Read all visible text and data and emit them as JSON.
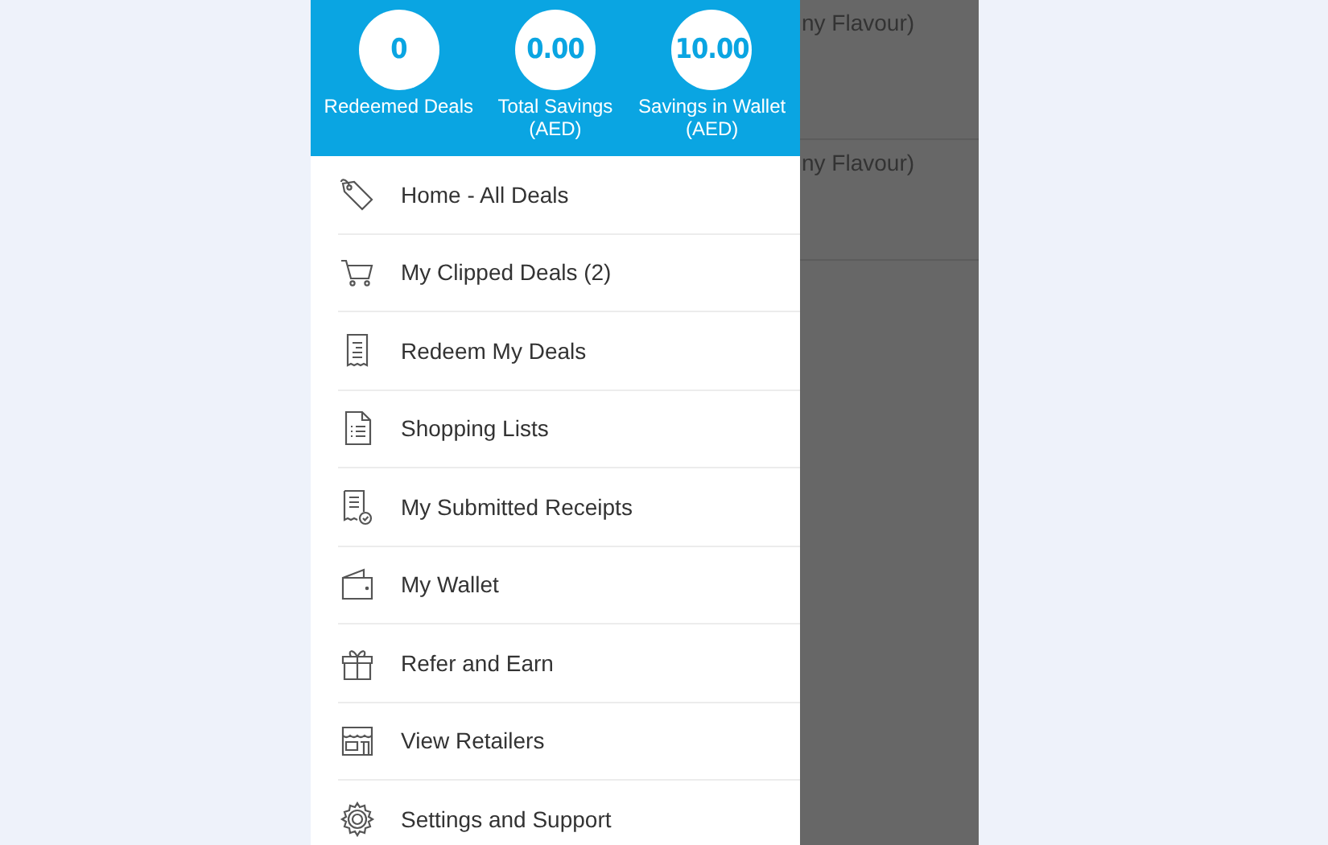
{
  "stats": [
    {
      "value": "0",
      "label": "Redeemed Deals"
    },
    {
      "value": "0.00",
      "label": "Total Savings (AED)"
    },
    {
      "value": "10.00",
      "label": "Savings in Wallet (AED)"
    }
  ],
  "menu": [
    {
      "label": "Home - All Deals",
      "kind": "tag"
    },
    {
      "label": "My Clipped Deals (2)",
      "kind": "cart"
    },
    {
      "label": "Redeem My Deals",
      "kind": "receipt"
    },
    {
      "label": "Shopping Lists",
      "kind": "list"
    },
    {
      "label": "My Submitted Receipts",
      "kind": "submitted"
    },
    {
      "label": "My Wallet",
      "kind": "wallet"
    },
    {
      "label": "Refer and Earn",
      "kind": "gift"
    },
    {
      "label": "View Retailers",
      "kind": "store"
    },
    {
      "label": "Settings and Support",
      "kind": "gear"
    }
  ],
  "background_rows": [
    {
      "text": "ny Flavour)"
    },
    {
      "text": "ny Flavour)"
    }
  ]
}
